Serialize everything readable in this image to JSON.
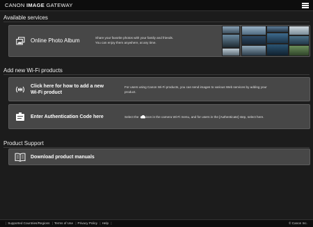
{
  "header": {
    "logo_canon": "CANON",
    "logo_image": "IMAGE",
    "logo_gateway": "GATEWAY",
    "menu_icon": "hamburger-menu-icon"
  },
  "sections": {
    "available_services": "Available services",
    "add_wifi": "Add new Wi-Fi products",
    "product_support": "Product Support"
  },
  "online_album": {
    "icon": "photo-album-icon",
    "title": "Online Photo Album",
    "desc_line1": "Share your favorite photos with your family and friends.",
    "desc_line2": "You can enjoy them anywhere, at any time."
  },
  "add_wifi_card": {
    "icon": "wifi-plus-icon",
    "title_line1": "Click here for how to add a new",
    "title_line2": "Wi-Fi product",
    "desc_line1": "For users using Canon Wi-Fi products, you can send images to various Web services by adding your",
    "desc_line2": "product."
  },
  "auth_card": {
    "icon": "authentication-code-icon",
    "title": "Enter Authentication Code here",
    "desc_before": "Select the",
    "desc_icon": "cloud-icon",
    "desc_after": "icon in the camera Wi-Fi menu, and for users in the [Authenticate] step, select here."
  },
  "manuals_card": {
    "icon": "book-icon",
    "title": "Download product manuals"
  },
  "footer": {
    "links": [
      "Supported Countries/Regions",
      "Terms of Use",
      "Privacy Policy",
      "Help"
    ],
    "copyright": "© Canon Inc."
  },
  "colors": {
    "background": "#1c1c1c",
    "card": "#474747",
    "bar": "#0d0d0d"
  }
}
